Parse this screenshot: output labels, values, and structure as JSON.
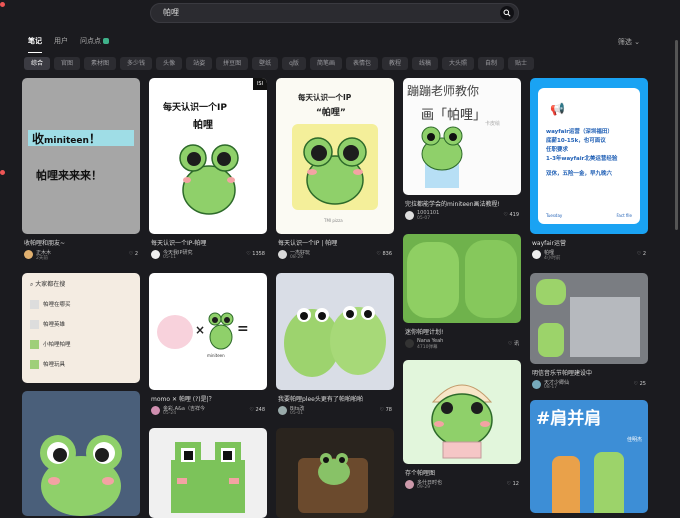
{
  "search": {
    "query": "帕哩"
  },
  "type_tabs": [
    "笔记",
    "用户",
    "问点点"
  ],
  "filter_label": "筛选",
  "categories": [
    "综合",
    "官图",
    "素材图",
    "多少钱",
    "头像",
    "站姿",
    "拼豆图",
    "壁纸",
    "q版",
    "简笔画",
    "表情包",
    "教程",
    "线稿",
    "大头照",
    "自制",
    "贴士"
  ],
  "cards": {
    "c1": {
      "thumb_text_1": "收",
      "thumb_text_1b": "miniteen",
      "thumb_text_1c": "！",
      "thumb_text_2": "帕哩来来来！",
      "title": "收帕哩和朋友~",
      "author": "正木木",
      "date": "2天前",
      "likes": "2"
    },
    "c2": {
      "thumb_text_1": "每天认识一个IP",
      "thumb_text_2": "帕哩",
      "badge": "ISI",
      "title": "每天认识一个IP-帕哩",
      "author": "今天我IP研究",
      "date": "05-11",
      "likes": "1358"
    },
    "c3": {
      "thumb_text_1": "每天认识一个IP",
      "thumb_text_2": "“帕哩”",
      "thumb_text_3": "TMI pizza",
      "title": "每天认识一个IP | 帕哩",
      "author": "一杰好玩",
      "date": "08-26",
      "likes": "836"
    },
    "c4": {
      "thumb_text_1": "蹦蹦老师教你",
      "thumb_text_2": "画「帕哩」",
      "thumb_text_3": "卡皮绘",
      "title": "完拉都能学会的miniteen画法教程!",
      "author": "1001101",
      "date": "05-07",
      "likes": "419"
    },
    "c5": {
      "line1": "wayfair运营（深圳福田）",
      "line2": "底薪10-15k，也可面议",
      "line3": "任职要求",
      "line4": "1-3年wayfair北美运营经验",
      "line5": "双休，五险一金，早九晚六",
      "footer_left": "Tuesday",
      "footer_right": "Fact file",
      "title": "wayfair运营",
      "author": "帕哩",
      "date": "4小时前",
      "likes": "2"
    },
    "c6": {
      "header": "大家都在搜",
      "items": [
        "帕哩在哪买",
        "帕哩英雄",
        "小帕哩帕哩",
        "帕哩玩具"
      ]
    },
    "c7": {
      "symbol_x": "×",
      "symbol_eq": "=",
      "sub": "miniteen",
      "title": "momo ✕ 帕哩 (?)是|？",
      "author": "金彩,A&a（吉祥今",
      "date": "05-24",
      "likes": "248"
    },
    "c8": {
      "title": "我要帕哩plee头更有了帕啪啪啪",
      "author": "Bits改",
      "date": "05-01",
      "likes": "78"
    },
    "c9": {
      "title": "迷你帕哩计划!",
      "author": "Nana Yeah",
      "date": "4710弹幕",
      "likes": "讯"
    },
    "c10": {
      "title": "明信音乐节帕哩建设中",
      "author": "天才少卿仙",
      "date": "08-17",
      "likes": "25"
    },
    "c11": {
      "title": "存个帕哩图",
      "author": "多什日时也",
      "date": "09-29",
      "likes": "12"
    },
    "c12": {
      "thumb_text": "#肩并肩",
      "sub": "佳明杰"
    }
  },
  "colors": {
    "bg": "#1b1b1f",
    "card_blue": "#1aa3f3",
    "frog_green": "#8fd06a",
    "frog_dark": "#2d6a2a"
  }
}
